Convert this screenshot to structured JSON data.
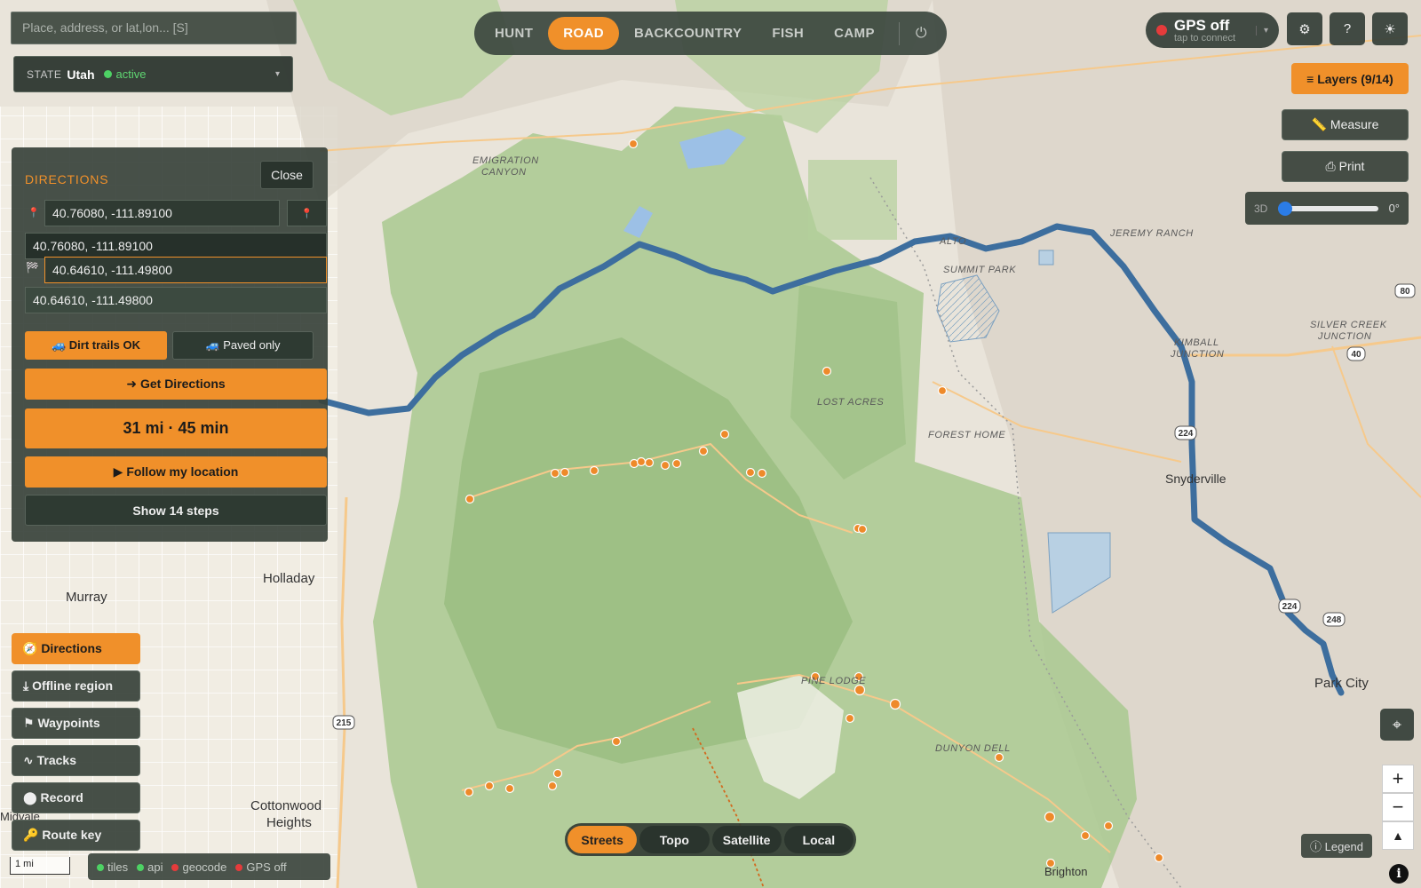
{
  "search": {
    "placeholder": "Place, address, or lat,lon... [S]"
  },
  "state_selector": {
    "label": "STATE",
    "value": "Utah",
    "status": "active"
  },
  "modes": [
    {
      "label": "HUNT",
      "active": false
    },
    {
      "label": "ROAD",
      "active": true
    },
    {
      "label": "BACKCOUNTRY",
      "active": false
    },
    {
      "label": "FISH",
      "active": false
    },
    {
      "label": "CAMP",
      "active": false
    }
  ],
  "power_icon": "power-icon",
  "gps": {
    "title": "GPS off",
    "subtitle": "tap to connect",
    "status_color": "#e53b3b"
  },
  "top_icons": {
    "settings": "⚙",
    "help": "?",
    "theme": "☀"
  },
  "right_controls": {
    "layers": "≡ Layers (9/14)",
    "measure": "📏 Measure",
    "print": "⎙ Print",
    "tilt_label": "3D",
    "tilt_value": "0°",
    "tilt_fraction": 0
  },
  "directions": {
    "title": "DIRECTIONS",
    "close_label": "Close",
    "origin_input": "40.76080, -111.89100",
    "origin_suggestion": "40.76080, -111.89100",
    "destination_input": "40.64610, -111.49800",
    "destination_suggestion": "40.64610, -111.49800",
    "dirt_trails": "🚙 Dirt trails OK",
    "paved_only": "🚙 Paved only",
    "get_directions": "➜ Get Directions",
    "summary": "31 mi · 45 min",
    "follow": "▶ Follow my location",
    "steps": "Show 14 steps"
  },
  "left_menu": [
    {
      "label": "🧭 Directions",
      "active": true
    },
    {
      "label": "⤓ Offline region",
      "active": false
    },
    {
      "label": "⚑ Waypoints",
      "active": false
    },
    {
      "label": "∿ Tracks",
      "active": false
    },
    {
      "label": "⬤ Record",
      "active": false
    },
    {
      "label": "🔑 Route key",
      "active": false
    }
  ],
  "scale_bar": "1 mi",
  "status_bar": [
    {
      "label": "tiles",
      "color": "#4dd264"
    },
    {
      "label": "api",
      "color": "#4dd264"
    },
    {
      "label": "geocode",
      "color": "#e53b3b"
    },
    {
      "label": "GPS off",
      "color": "#e53b3b"
    }
  ],
  "basemaps": [
    {
      "label": "Streets",
      "active": true
    },
    {
      "label": "Topo",
      "active": false
    },
    {
      "label": "Satellite",
      "active": false
    },
    {
      "label": "Local",
      "active": false
    }
  ],
  "legend_label": "ⓘ Legend",
  "info_label": "i",
  "map_labels": {
    "emigration": "EMIGRATION",
    "canyon": "CANYON",
    "alto": "ALTO",
    "summit_park": "SUMMIT PARK",
    "jeremy_ranch": "JEREMY RANCH",
    "lost_acres": "LOST ACRES",
    "forest_home": "FOREST HOME",
    "kimball": "KIMBALL",
    "junction": "JUNCTION",
    "silver_creek": "SILVER CREEK",
    "silver_junction": "JUNCTION",
    "snyderville": "Snyderville",
    "holladay": "Holladay",
    "murray": "Murray",
    "pine_lodge": "PINE LODGE",
    "dunyon_dell": "DUNYON DELL",
    "park_city": "Park City",
    "cottonwood": "Cottonwood",
    "heights": "Heights",
    "midvale": "Midvale",
    "brighton": "Brighton"
  },
  "shields": {
    "i80": "80",
    "i215": "215",
    "r224a": "224",
    "r224b": "224",
    "r248": "248",
    "r40": "40",
    "i80e": "80"
  },
  "colors": {
    "accent": "#f0902a",
    "route": "#3d6e9e",
    "forest": "#a9c98f"
  }
}
